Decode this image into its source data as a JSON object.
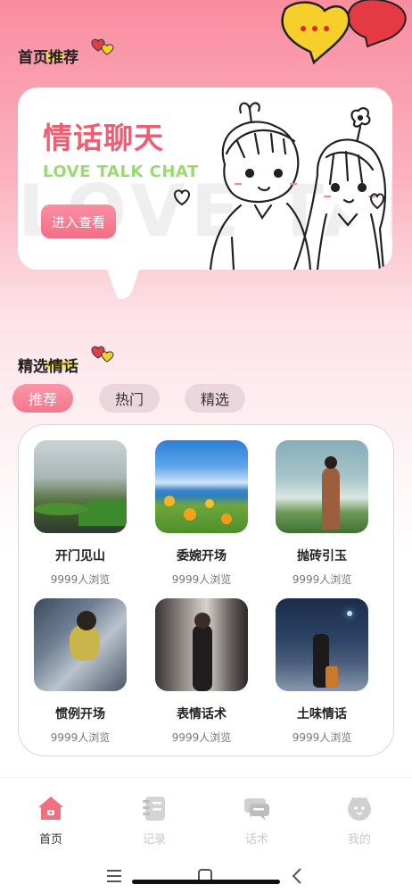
{
  "header": {
    "title": "首页推荐"
  },
  "banner": {
    "title": "情话聊天",
    "subtitle": "LOVE TALK CHAT",
    "button_label": "进入查看",
    "watermark": "LOVE TALK"
  },
  "section": {
    "title": "精选情话"
  },
  "tabs": [
    {
      "label": "推荐",
      "active": true
    },
    {
      "label": "热门",
      "active": false
    },
    {
      "label": "精选",
      "active": false
    }
  ],
  "items": [
    {
      "title": "开门见山",
      "views": "9999人浏览"
    },
    {
      "title": "委婉开场",
      "views": "9999人浏览"
    },
    {
      "title": "抛砖引玉",
      "views": "9999人浏览"
    },
    {
      "title": "惯例开场",
      "views": "9999人浏览"
    },
    {
      "title": "表情话术",
      "views": "9999人浏览"
    },
    {
      "title": "土味情话",
      "views": "9999人浏览"
    }
  ],
  "nav": [
    {
      "label": "首页",
      "icon": "home-icon",
      "active": true
    },
    {
      "label": "记录",
      "icon": "record-icon",
      "active": false
    },
    {
      "label": "话术",
      "icon": "chat-icon",
      "active": false
    },
    {
      "label": "我的",
      "icon": "profile-icon",
      "active": false
    }
  ],
  "colors": {
    "accent": "#ee5d73",
    "accent_light": "#fb97a9",
    "subtitle_green": "#98db6e",
    "inactive_tab": "#ecd6dd",
    "nav_inactive": "#cfcfcf"
  }
}
